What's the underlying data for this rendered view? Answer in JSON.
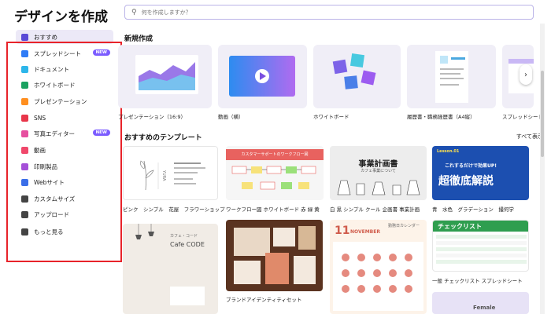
{
  "app": {
    "title": "デザインを作成"
  },
  "search": {
    "placeholder": "何を作成しますか？"
  },
  "sidebar": {
    "items": [
      {
        "label": "おすすめ",
        "icon": "sparkle-icon",
        "color": "#5b4bd6",
        "active": true
      },
      {
        "label": "スプレッドシート",
        "icon": "spreadsheet-icon",
        "color": "#2f7cf6",
        "badge": "NEW"
      },
      {
        "label": "ドキュメント",
        "icon": "document-icon",
        "color": "#2db6ea"
      },
      {
        "label": "ホワイトボード",
        "icon": "whiteboard-icon",
        "color": "#1aa261"
      },
      {
        "label": "プレゼンテーション",
        "icon": "presentation-icon",
        "color": "#ff8f1f"
      },
      {
        "label": "SNS",
        "icon": "heart-icon",
        "color": "#e8364a"
      },
      {
        "label": "写真エディター",
        "icon": "photo-editor-icon",
        "color": "#e64fa0",
        "badge": "NEW"
      },
      {
        "label": "動画",
        "icon": "video-icon",
        "color": "#f0486b"
      },
      {
        "label": "印刷製品",
        "icon": "print-icon",
        "color": "#a550d8"
      },
      {
        "label": "Webサイト",
        "icon": "website-icon",
        "color": "#3a6ee8"
      },
      {
        "label": "カスタムサイズ",
        "icon": "custom-size-icon",
        "color": "#444444"
      },
      {
        "label": "アップロード",
        "icon": "upload-icon",
        "color": "#444444"
      },
      {
        "label": "もっと見る",
        "icon": "more-icon",
        "color": "#444444"
      }
    ]
  },
  "new_section": {
    "title": "新規作成",
    "cards": [
      {
        "label": "プレゼンテーション（16:9）"
      },
      {
        "label": "動画（横）"
      },
      {
        "label": "ホワイトボード"
      },
      {
        "label": "履歴書・職務経歴書（A4縦）"
      },
      {
        "label": "スプレッドシート"
      }
    ],
    "next_icon": "›"
  },
  "templates_section": {
    "title": "おすすめのテンプレート",
    "show_all": "すべて表示",
    "cards": [
      {
        "label": "ピンク　シンプル　花屋　フラワーショップ"
      },
      {
        "label": "ワークフロー図 ホワイトボード 赤 緑 黄"
      },
      {
        "label": "白 黒 シンプル クール 企画書 事業計画"
      },
      {
        "label": "青　水色　グラデーション　撮何学"
      },
      {
        "label": ""
      },
      {
        "label": "ブランドアイデンティティセット"
      },
      {
        "label": ""
      },
      {
        "label": "一般 チェックリスト スプレッドシート"
      }
    ],
    "card_texts": {
      "flower_name": "YURA",
      "flow_title": "カスタマーサポートのワークフロー図",
      "plan_title": "事業計画書",
      "plan_sub": "カフェ事業について",
      "lesson": "Lesson.01",
      "lesson_big": "超徹底解説",
      "lesson_sub": "これするだけで効果UP!",
      "cafe_sub": "カフェ・コード",
      "cafe_title": "Cafe CODE",
      "cal_title": "勤務日カレンダー",
      "cal_month": "11",
      "cal_month_word": "NOVEMBER",
      "checklist_title": "チェックリスト",
      "female": "Female"
    }
  }
}
